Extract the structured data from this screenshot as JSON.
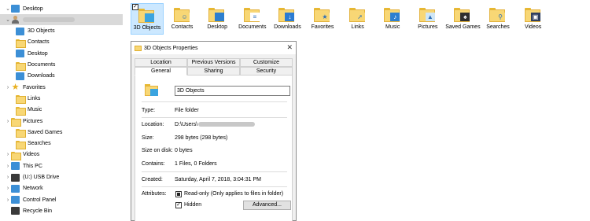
{
  "sidebar": {
    "items": [
      {
        "label": "Desktop",
        "icon": "desktop-icon",
        "chevron": "⌄"
      },
      {
        "label": "",
        "icon": "user-folder-icon",
        "chevron": "⌄",
        "redacted": true
      },
      {
        "label": "3D Objects",
        "icon": "3d-objects-icon",
        "chevron": ""
      },
      {
        "label": "Contacts",
        "icon": "contacts-icon",
        "chevron": ""
      },
      {
        "label": "Desktop",
        "icon": "desktop-icon",
        "chevron": ""
      },
      {
        "label": "Documents",
        "icon": "documents-icon",
        "chevron": ""
      },
      {
        "label": "Downloads",
        "icon": "downloads-icon",
        "chevron": ""
      },
      {
        "label": "Favorites",
        "icon": "favorites-icon",
        "chevron": "›"
      },
      {
        "label": "Links",
        "icon": "links-icon",
        "chevron": ""
      },
      {
        "label": "Music",
        "icon": "music-icon",
        "chevron": ""
      },
      {
        "label": "Pictures",
        "icon": "pictures-icon",
        "chevron": "›"
      },
      {
        "label": "Saved Games",
        "icon": "saved-games-icon",
        "chevron": ""
      },
      {
        "label": "Searches",
        "icon": "searches-icon",
        "chevron": ""
      },
      {
        "label": "Videos",
        "icon": "videos-icon",
        "chevron": "›"
      },
      {
        "label": "This PC",
        "icon": "this-pc-icon",
        "chevron": "›"
      },
      {
        "label": "(U:) USB Drive",
        "icon": "usb-drive-icon",
        "chevron": "›"
      },
      {
        "label": "Network",
        "icon": "network-icon",
        "chevron": "›"
      },
      {
        "label": "Control Panel",
        "icon": "control-panel-icon",
        "chevron": "›"
      },
      {
        "label": "Recycle Bin",
        "icon": "recycle-bin-icon",
        "chevron": ""
      }
    ]
  },
  "folders": [
    {
      "label": "3D Objects",
      "emblem": "3d-objects-icon",
      "selected": true
    },
    {
      "label": "Contacts",
      "emblem": "contacts-icon"
    },
    {
      "label": "Desktop",
      "emblem": "desktop-icon"
    },
    {
      "label": "Documents",
      "emblem": "documents-icon"
    },
    {
      "label": "Downloads",
      "emblem": "downloads-icon"
    },
    {
      "label": "Favorites",
      "emblem": "favorites-icon"
    },
    {
      "label": "Links",
      "emblem": "links-icon"
    },
    {
      "label": "Music",
      "emblem": "music-icon"
    },
    {
      "label": "Pictures",
      "emblem": "pictures-icon"
    },
    {
      "label": "Saved Games",
      "emblem": "saved-games-icon"
    },
    {
      "label": "Searches",
      "emblem": "searches-icon"
    },
    {
      "label": "Videos",
      "emblem": "videos-icon"
    }
  ],
  "dialog": {
    "title": "3D Objects Properties",
    "close_glyph": "✕",
    "tabs_row1": [
      "Location",
      "Previous Versions",
      "Customize"
    ],
    "tabs_row2": [
      "General",
      "Sharing",
      "Security"
    ],
    "name_value": "3D Objects",
    "props": {
      "type_label": "Type:",
      "type_value": "File folder",
      "location_label": "Location:",
      "location_value": "D:\\Users\\",
      "size_label": "Size:",
      "size_value": "298 bytes (298 bytes)",
      "size_on_disk_label": "Size on disk:",
      "size_on_disk_value": "0 bytes",
      "contains_label": "Contains:",
      "contains_value": "1 Files, 0 Folders",
      "created_label": "Created:",
      "created_value": "Saturday, April 7, 2018, 3:04:31 PM",
      "attributes_label": "Attributes:",
      "readonly_label": "Read-only (Only applies to files in folder)",
      "hidden_label": "Hidden",
      "advanced_label": "Advanced..."
    }
  },
  "colors": {
    "folder_yellow": "#f8d775",
    "selection_blue": "#cce8ff",
    "sidebar_selected": "#d9d9d9",
    "accent_blue": "#3c8fd6"
  }
}
